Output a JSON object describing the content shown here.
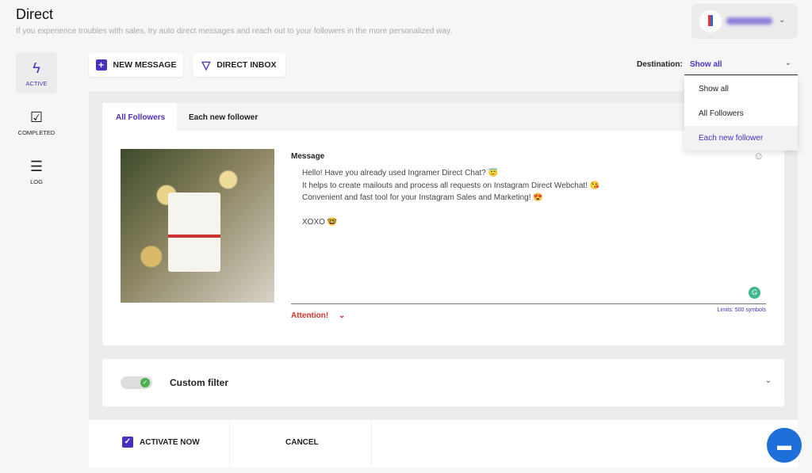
{
  "header": {
    "title": "Direct",
    "subtitle": "If you experience troubles with sales, try auto direct messages and reach out to your followers in the more personalized way."
  },
  "sidebar": {
    "items": [
      {
        "label": "ACTIVE",
        "icon": "lightning-icon"
      },
      {
        "label": "COMPLETED",
        "icon": "checkbox-icon"
      },
      {
        "label": "LOG",
        "icon": "menu-icon"
      }
    ]
  },
  "toolbar": {
    "new_message": "NEW MESSAGE",
    "direct_inbox": "DIRECT INBOX",
    "destination_label": "Destination:",
    "destination_value": "Show all"
  },
  "dropdown": {
    "options": [
      "Show all",
      "All Followers",
      "Each new follower"
    ]
  },
  "tabs": [
    "All Followers",
    "Each new follower"
  ],
  "message": {
    "label": "Message",
    "lines": [
      "Hello! Have you already used Ingramer Direct Chat? 😇",
      "It helps to create mailouts and process all requests on Instagram Direct Webchat! 😘",
      "Convenient and fast tool for your Instagram Sales and Marketing! 😍",
      "",
      "XOXO 🤓"
    ],
    "limit": "Limits: 500 symbols",
    "attention": "Attention!"
  },
  "filter": {
    "label": "Custom filter",
    "enabled": true
  },
  "footer": {
    "activate": "ACTIVATE NOW",
    "cancel": "CANCEL"
  },
  "colors": {
    "accent": "#4b2fc0",
    "danger": "#d0342c",
    "toggle": "#4caf50",
    "chat": "#1e6fd9"
  }
}
